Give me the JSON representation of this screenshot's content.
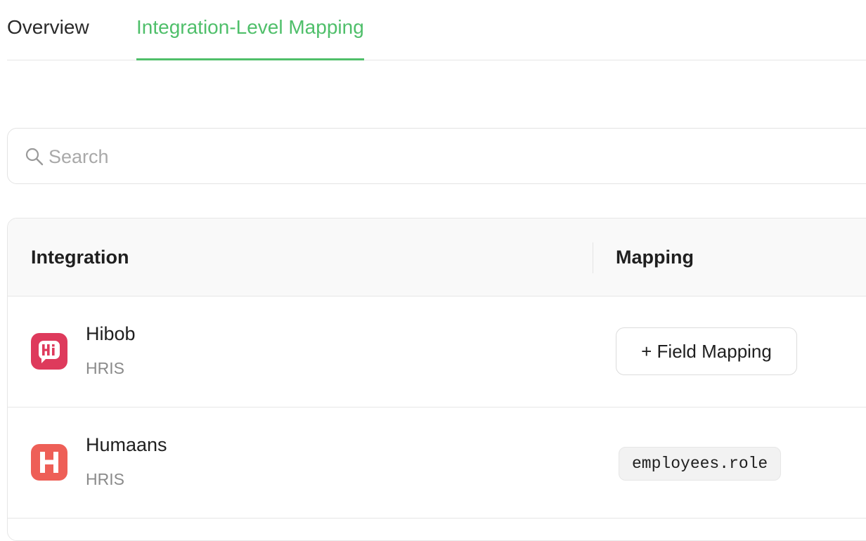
{
  "tabs": [
    {
      "label": "Overview",
      "active": false
    },
    {
      "label": "Integration-Level Mapping",
      "active": true
    }
  ],
  "accent_color": "#4fbf6a",
  "search": {
    "placeholder": "Search",
    "value": "",
    "icon": "search-icon"
  },
  "table": {
    "columns": [
      "Integration",
      "Mapping"
    ],
    "rows": [
      {
        "name": "Hibob",
        "category": "HRIS",
        "logo": "hibob-logo",
        "logo_color": "#de3a5c",
        "mapping_action": "+ Field Mapping"
      },
      {
        "name": "Humaans",
        "category": "HRIS",
        "logo": "humaans-logo",
        "logo_color": "#ee5f57",
        "mapping_value": "employees.role"
      }
    ]
  }
}
